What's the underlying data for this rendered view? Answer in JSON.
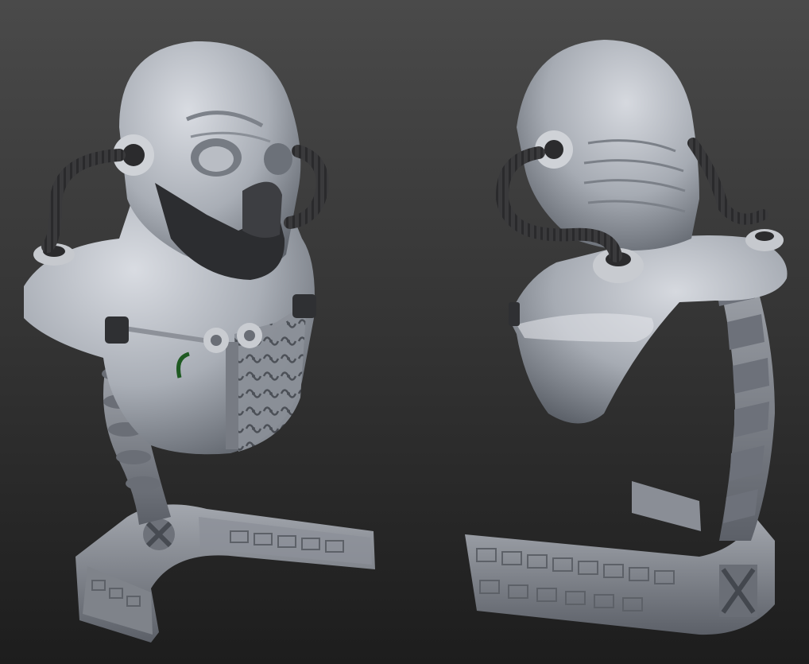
{
  "scene": {
    "background_top": "#4a4a4a",
    "background_bottom": "#1d1d1d",
    "model_base_color": "#aeb3bb",
    "model_shadow_color": "#6e737b",
    "hose_color": "#3c3c3e",
    "jaw_color": "#2c2d30",
    "wire_accent_color": "#1f5a22",
    "views": [
      {
        "view": "front-three-quarter",
        "icon": "sculpt-bust-front"
      },
      {
        "view": "back-three-quarter",
        "icon": "sculpt-bust-back"
      }
    ]
  }
}
